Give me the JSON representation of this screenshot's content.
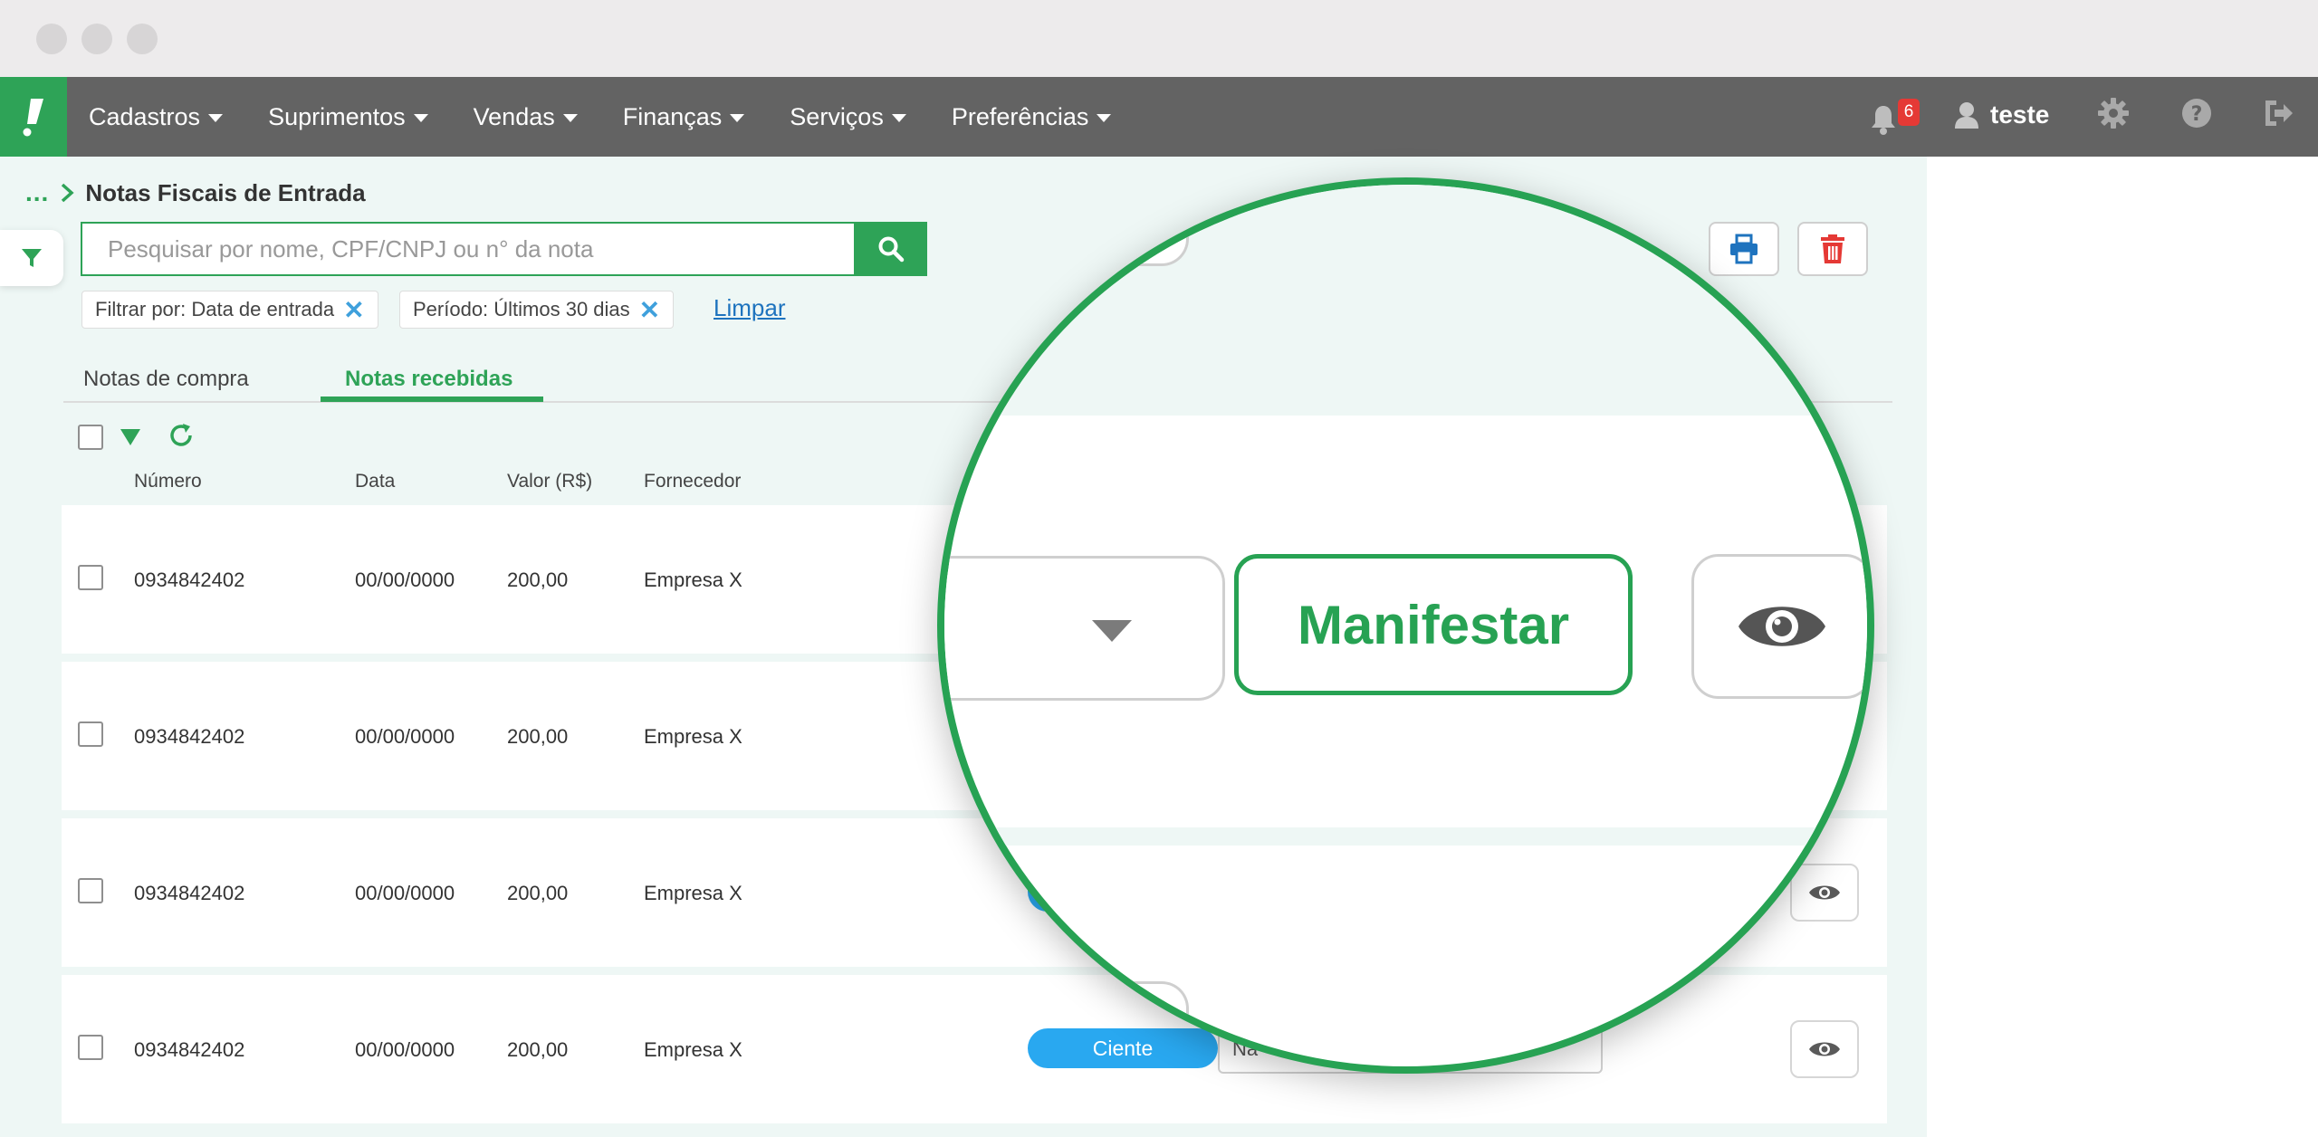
{
  "nav": {
    "menu": [
      {
        "label": "Cadastros"
      },
      {
        "label": "Suprimentos"
      },
      {
        "label": "Vendas"
      },
      {
        "label": "Finanças"
      },
      {
        "label": "Serviços"
      },
      {
        "label": "Preferências"
      }
    ],
    "notification_count": "6",
    "username": "teste"
  },
  "breadcrumb": {
    "more": "...",
    "title": "Notas Fiscais de Entrada"
  },
  "search": {
    "placeholder": "Pesquisar por nome, CPF/CNPJ ou n° da nota"
  },
  "filters": {
    "chips": [
      {
        "label": "Filtrar por: Data de entrada"
      },
      {
        "label": "Período: Últimos 30 dias"
      }
    ],
    "clear_label": "Limpar"
  },
  "tabs": [
    {
      "label": "Notas de compra"
    },
    {
      "label": "Notas recebidas"
    }
  ],
  "table": {
    "headers": {
      "numero": "Número",
      "data": "Data",
      "valor": "Valor (R$)",
      "fornecedor": "Fornecedor"
    },
    "rows": [
      {
        "numero": "0934842402",
        "data": "00/00/0000",
        "valor": "200,00",
        "fornecedor": "Empresa X"
      },
      {
        "numero": "0934842402",
        "data": "00/00/0000",
        "valor": "200,00",
        "fornecedor": "Empresa X"
      },
      {
        "numero": "0934842402",
        "data": "00/00/0000",
        "valor": "200,00",
        "fornecedor": "Empresa X",
        "status": ""
      },
      {
        "numero": "0934842402",
        "data": "00/00/0000",
        "valor": "200,00",
        "fornecedor": "Empresa X",
        "status": "Ciente",
        "select_value": "Na"
      }
    ]
  },
  "magnifier": {
    "button_label": "Manifestar"
  },
  "colors": {
    "brand_green": "#2ea357",
    "nav_gray": "#636363",
    "status_blue": "#29a8f0",
    "danger_red": "#e53935",
    "link_blue": "#1e73be"
  }
}
